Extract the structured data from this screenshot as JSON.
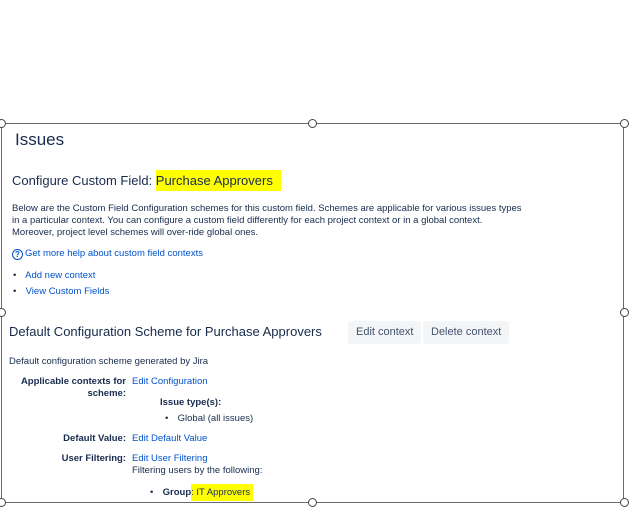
{
  "page": {
    "heading": "Issues",
    "subheading_prefix": "Configure Custom Field: ",
    "field_name": "Purchase Approvers",
    "description_lines": [
      "Below are the Custom Field Configuration schemes for this custom field. Schemes are applicable for various issues types",
      "in a particular context. You can configure a custom field differently for each project context or in a global context.",
      "Moreover, project level schemes will over-ride global ones."
    ],
    "help_link": "Get more help about custom field contexts",
    "help_icon": "question-circle-icon",
    "links": [
      "Add new context",
      "View Custom Fields"
    ]
  },
  "scheme": {
    "title": "Default Configuration Scheme for Purchase Approvers",
    "edit_context": "Edit context",
    "delete_context": "Delete context",
    "description": "Default configuration scheme generated by Jira",
    "applicable_label_1": "Applicable contexts for",
    "applicable_label_2": "scheme:",
    "edit_configuration": "Edit Configuration",
    "issue_types_label": "Issue type(s):",
    "issue_type_value": "Global (all issues)",
    "default_value_label": "Default Value:",
    "edit_default_value": "Edit Default Value",
    "user_filtering_label": "User Filtering:",
    "edit_user_filtering": "Edit User Filtering",
    "filtering_text": "Filtering users by the following:",
    "group_label": "Group",
    "group_sep": ": ",
    "group_value": "IT Approvers"
  },
  "colors": {
    "highlight": "#ffff00",
    "link": "#0052cc",
    "text": "#172b4d",
    "button_bg": "#f4f5f7"
  }
}
